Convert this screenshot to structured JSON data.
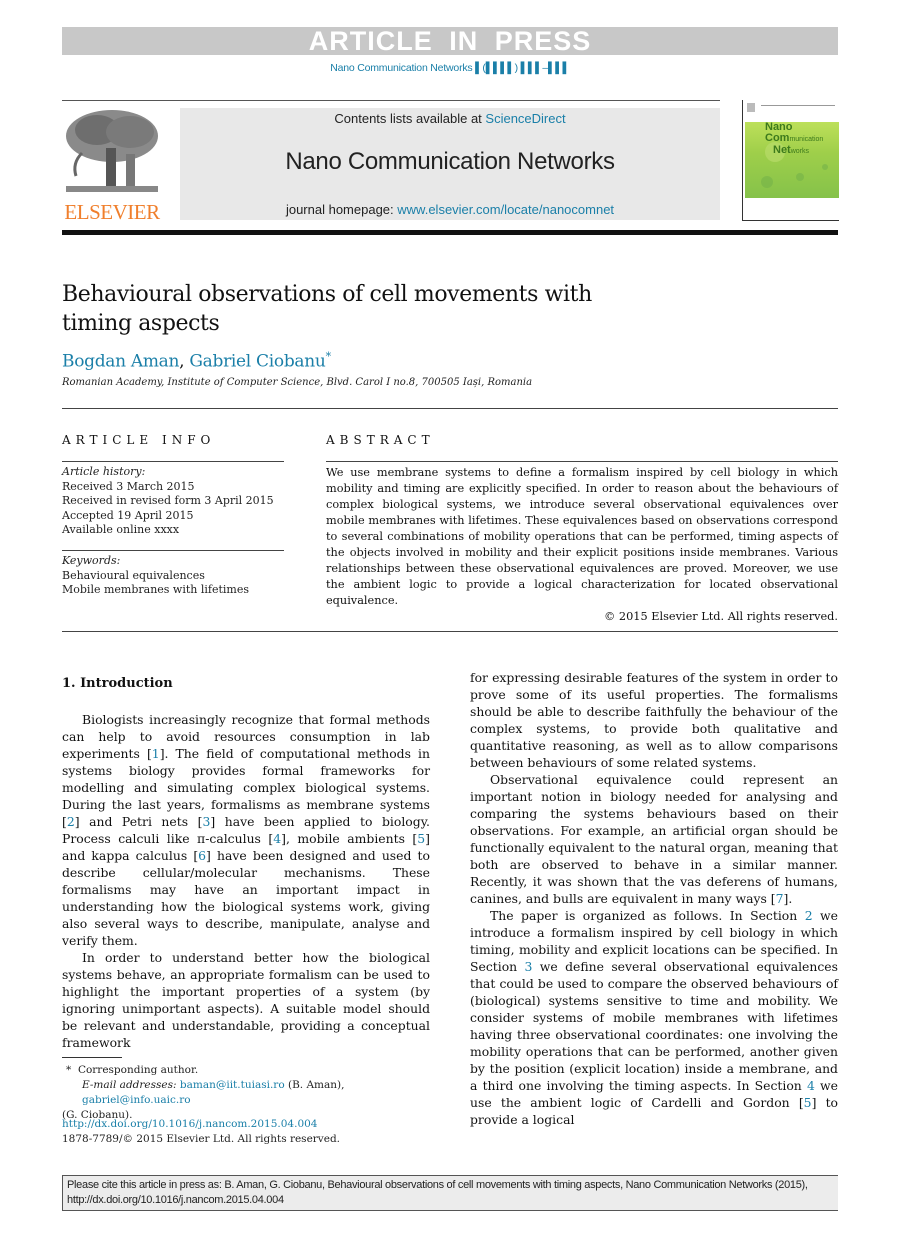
{
  "banner": "ARTICLE IN PRESS",
  "journal_ref": "Nano Communication Networks ▌(▌▌▌▌) ▌▌▌–▌▌▌",
  "header": {
    "publisher_logo": "ELSEVIER",
    "contents_prefix": "Contents lists available at ",
    "contents_link": "ScienceDirect",
    "journal_title": "Nano Communication Networks",
    "homepage_prefix": "journal homepage: ",
    "homepage_link": "www.elsevier.com/locate/nanocomnet",
    "cover": {
      "line1": "Nano",
      "line2a": "Com",
      "line2b": "munication",
      "line3a": "Net",
      "line3b": "works"
    }
  },
  "article": {
    "title": "Behavioural observations of cell movements with timing aspects",
    "authors": [
      {
        "name": "Bogdan Aman"
      },
      {
        "name": "Gabriel Ciobanu",
        "mark": "*"
      }
    ],
    "author_separator": ",",
    "affiliation": "Romanian Academy, Institute of Computer Science, Blvd. Carol I no.8, 700505 Iași, Romania"
  },
  "article_info": {
    "heading": "ARTICLE INFO",
    "history_label": "Article history:",
    "history": [
      "Received 3 March 2015",
      "Received in revised form 3 April 2015",
      "Accepted 19 April 2015",
      "Available online xxxx"
    ],
    "keywords_label": "Keywords:",
    "keywords": [
      "Behavioural equivalences",
      "Mobile membranes with lifetimes"
    ]
  },
  "abstract": {
    "heading": "ABSTRACT",
    "text": "We use membrane systems to define a formalism inspired by cell biology in which mobility and timing are explicitly specified. In order to reason about the behaviours of complex biological systems, we introduce several observational equivalences over mobile membranes with lifetimes. These equivalences based on observations correspond to several combinations of mobility operations that can be performed, timing aspects of the objects involved in mobility and their explicit positions inside membranes. Various relationships between these observational equivalences are proved. Moreover, we use the ambient logic to provide a logical characterization for located observational equivalence.",
    "copyright": "© 2015 Elsevier Ltd. All rights reserved."
  },
  "intro": {
    "heading": "1.  Introduction",
    "p1": [
      "Biologists increasingly recognize that formal methods can help to avoid resources consumption in lab experiments [",
      "1",
      "]. The field of computational methods in systems biology provides formal frameworks for modelling and simulating complex biological systems. During the last years, formalisms as membrane systems [",
      "2",
      "] and Petri nets [",
      "3",
      "] have been applied to biology. Process calculi like π-calculus [",
      "4",
      "], mobile ambients [",
      "5",
      "] and kappa calculus [",
      "6",
      "] have been designed and used to describe cellular/molecular mechanisms. These formalisms may have an important impact in understanding how the biological systems work, giving also several ways to describe, manipulate, analyse and verify them."
    ],
    "p2": "In order to understand better how the biological systems behave, an appropriate formalism can be used to highlight the important properties of a system (by ignoring unimportant aspects). A suitable model should be relevant and understandable, providing a conceptual framework",
    "p2_cont": "for expressing desirable features of the system in order to prove some of its useful properties. The formalisms should be able to describe faithfully the behaviour of the complex systems, to provide both qualitative and quantitative reasoning, as well as to allow comparisons between behaviours of some related systems.",
    "p3": [
      "Observational equivalence could represent an important notion in biology needed for analysing and comparing the systems behaviours based on their observations. For example, an artificial organ should be functionally equivalent to the natural organ, meaning that both are observed to behave in a similar manner. Recently, it was shown that the vas deferens of humans, canines, and bulls are equivalent in many ways [",
      "7",
      "]."
    ],
    "p4": [
      "The paper is organized as follows. In Section ",
      "2",
      " we introduce a formalism inspired by cell biology in which timing, mobility and explicit locations can be specified. In Section ",
      "3",
      " we define several observational equivalences that could be used to compare the observed behaviours of (biological) systems sensitive to time and mobility. We consider systems of mobile membranes with lifetimes having three observational coordinates: one involving the mobility operations that can be performed, another given by the position (explicit location) inside a membrane, and a third one involving the timing aspects. In Section ",
      "4",
      " we use the ambient logic of Cardelli and Gordon [",
      "5",
      "] to provide a logical"
    ]
  },
  "footnote": {
    "mark": "*",
    "corresponding": "Corresponding author.",
    "email_label": "E-mail addresses: ",
    "email1": "baman@iit.tuiasi.ro",
    "email1_owner": " (B. Aman), ",
    "email2": "gabriel@info.uaic.ro",
    "email2_owner": " (G. Ciobanu)."
  },
  "doi": {
    "link": "http://dx.doi.org/10.1016/j.nancom.2015.04.004",
    "issn": "1878-7789/© 2015 Elsevier Ltd. All rights reserved."
  },
  "citation_box": "Please cite this article in press as: B. Aman, G. Ciobanu, Behavioural observations of cell movements with timing aspects, Nano Communication Networks (2015), http://dx.doi.org/10.1016/j.nancom.2015.04.004"
}
